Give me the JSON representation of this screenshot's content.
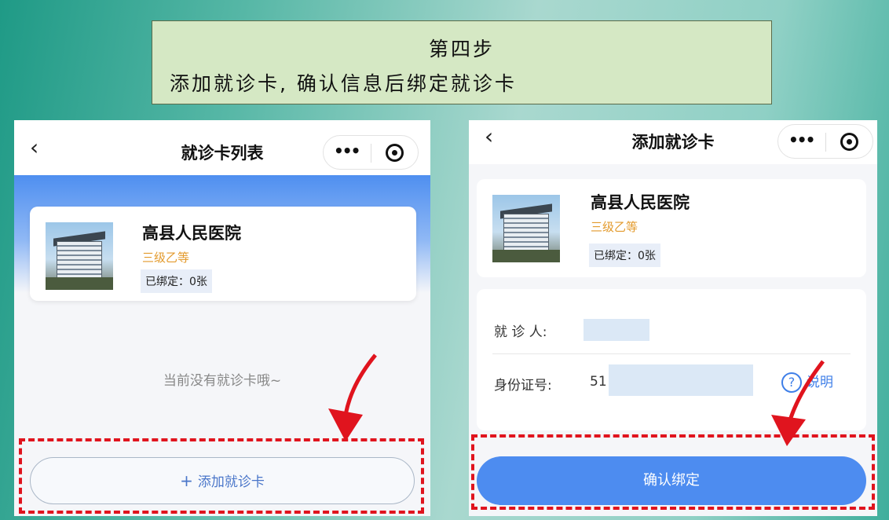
{
  "banner": {
    "line1": "第四步",
    "line2": "添加就诊卡, 确认信息后绑定就诊卡"
  },
  "left_screen": {
    "back_icon": "‹",
    "title": "就诊卡列表",
    "capsule_more": "•••",
    "hospital": {
      "name": "高县人民医院",
      "level": "三级乙等",
      "bound": "已绑定：0张"
    },
    "empty_text": "当前没有就诊卡哦~",
    "add_button": {
      "plus": "+",
      "label": "添加就诊卡"
    }
  },
  "right_screen": {
    "back_icon": "‹",
    "title": "添加就诊卡",
    "capsule_more": "•••",
    "hospital": {
      "name": "高县人民医院",
      "level": "三级乙等",
      "bound": "已绑定：0张"
    },
    "form": {
      "patient_label": "就 诊 人:",
      "id_label": "身份证号:",
      "id_value": "51",
      "help_icon": "?",
      "help_label": "说明"
    },
    "confirm_button": "确认绑定"
  },
  "colors": {
    "primary_blue": "#4d8cf0",
    "level_orange": "#e39a2c",
    "annotation_red": "#e0141e",
    "banner_bg": "#d5e8c4"
  }
}
